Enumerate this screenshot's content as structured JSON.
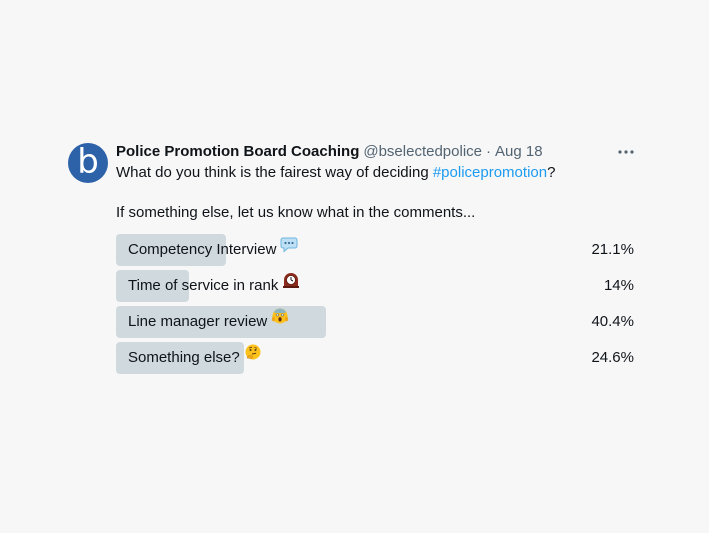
{
  "author": {
    "display_name": "Police Promotion Board Coaching",
    "handle": "@bselectedpolice",
    "separator": "·",
    "date": "Aug 18",
    "avatar_letter": "b",
    "avatar_color": "#2d62a8"
  },
  "tweet": {
    "question_prefix": "What do you think is the fairest way of deciding ",
    "hashtag": "#policepromotion",
    "question_suffix": "?",
    "followup": "If something else, let us know what in the comments..."
  },
  "poll": {
    "options": [
      {
        "label": "Competency Interview",
        "emoji": "speech-balloon-icon",
        "percent_label": "21.1%",
        "percent": 21.1
      },
      {
        "label": "Time of service in rank",
        "emoji": "mantelpiece-clock-icon",
        "percent_label": "14%",
        "percent": 14
      },
      {
        "label": "Line manager review",
        "emoji": "screaming-face-icon",
        "percent_label": "40.4%",
        "percent": 40.4
      },
      {
        "label": "Something else?",
        "emoji": "thinking-face-icon",
        "percent_label": "24.6%",
        "percent": 24.6
      }
    ]
  },
  "colors": {
    "bar": "#cfd9de",
    "link": "#1d9bf0",
    "secondary_text": "#536471"
  },
  "menu_icon": "more-horizontal-icon"
}
